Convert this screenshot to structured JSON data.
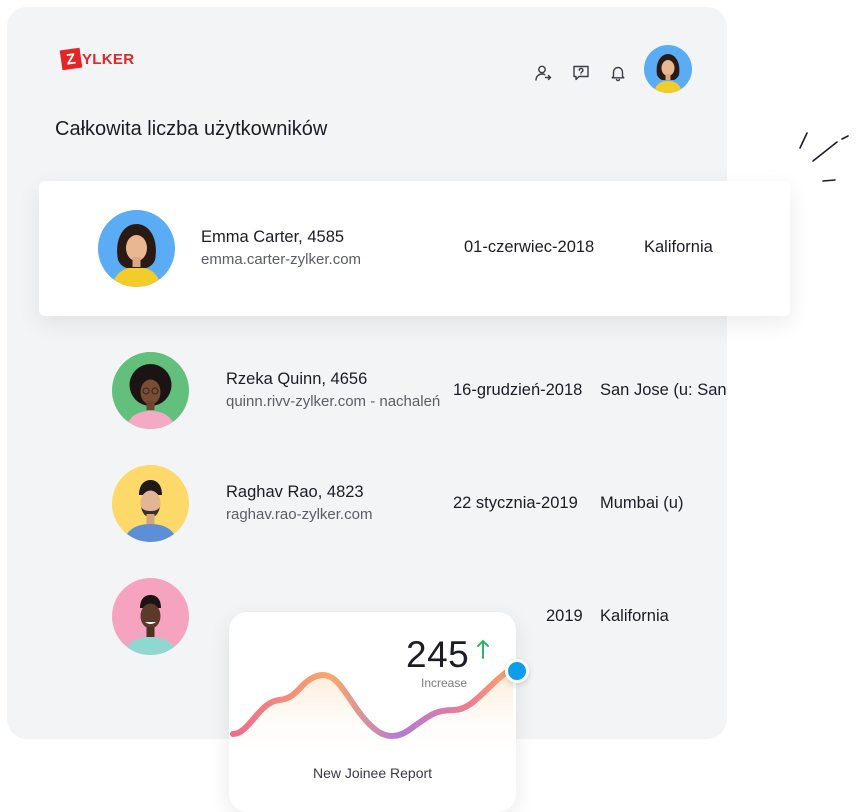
{
  "brand": {
    "logo_letter": "Z",
    "logo_text": "YLKER",
    "color": "#e42527"
  },
  "header": {
    "icons": [
      "user-switch-icon",
      "help-icon",
      "bell-icon"
    ],
    "avatar": "profile-avatar"
  },
  "page_title": "Całkowita liczba użytkowników",
  "users": [
    {
      "name": "Emma Carter, 4585",
      "email": "emma.carter-zylker.com",
      "date": "01-czerwiec-2018",
      "location": "Kalifornia",
      "avatar_bg": "#5aacf5"
    },
    {
      "name": "Rzeka Quinn, 4656",
      "email": "quinn.rivv-zylker.com - nachaleń",
      "date": "16-grudzień-2018",
      "location": "San Jose (u: San",
      "avatar_bg": "#62c07c"
    },
    {
      "name": "Raghav Rao, 4823",
      "email": "raghav.rao-zylker.com",
      "date": "22 stycznia-2019",
      "location": "Mumbai (u)",
      "avatar_bg": "#fdd96a"
    },
    {
      "name": "",
      "email": "",
      "date": "2019",
      "location": "Kalifornia",
      "avatar_bg": "#f6a3bf"
    }
  ],
  "report": {
    "value": "245",
    "trend_icon": "arrow-up-icon",
    "trend_color": "#2fb36b",
    "sub_label": "Increase",
    "title": "New Joinee Report",
    "marker_color": "#0c9ded"
  }
}
